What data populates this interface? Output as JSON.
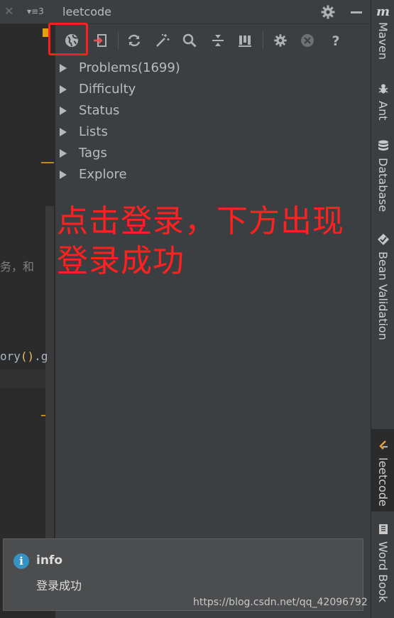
{
  "editor": {
    "tab_count": "3",
    "code_line_1": "务，和",
    "code_line_2_text": "ory",
    "code_line_2_parens": "()",
    "code_line_2_tail": ".g"
  },
  "tool_window": {
    "title": "leetcode",
    "toolbar": [
      {
        "name": "login-globe-icon"
      },
      {
        "name": "logout-icon"
      },
      {
        "name": "refresh-icon"
      },
      {
        "name": "magic-wand-icon"
      },
      {
        "name": "search-icon"
      },
      {
        "name": "collapse-all-icon"
      },
      {
        "name": "progress-chart-icon"
      },
      {
        "name": "settings-gear-icon"
      },
      {
        "name": "clear-icon"
      },
      {
        "name": "help-icon"
      }
    ]
  },
  "tree": {
    "items": [
      {
        "label": "Problems(1699)"
      },
      {
        "label": "Difficulty"
      },
      {
        "label": "Status"
      },
      {
        "label": "Lists"
      },
      {
        "label": "Tags"
      },
      {
        "label": "Explore"
      }
    ]
  },
  "annotation": {
    "line1": "点击登录，下方出现",
    "line2": "登录成功",
    "color": "#ff2020"
  },
  "right_stripe": {
    "items": [
      {
        "label": "Maven",
        "icon": "maven-m-icon"
      },
      {
        "label": "Ant",
        "icon": "ant-icon"
      },
      {
        "label": "Database",
        "icon": "database-icon"
      },
      {
        "label": "Bean Validation",
        "icon": "bean-validation-icon"
      },
      {
        "label": "leetcode",
        "icon": "leetcode-icon"
      },
      {
        "label": "Word Book",
        "icon": "book-icon"
      }
    ]
  },
  "notification": {
    "title": "info",
    "message": "登录成功"
  },
  "watermark": "https://blog.csdn.net/qq_42096792"
}
